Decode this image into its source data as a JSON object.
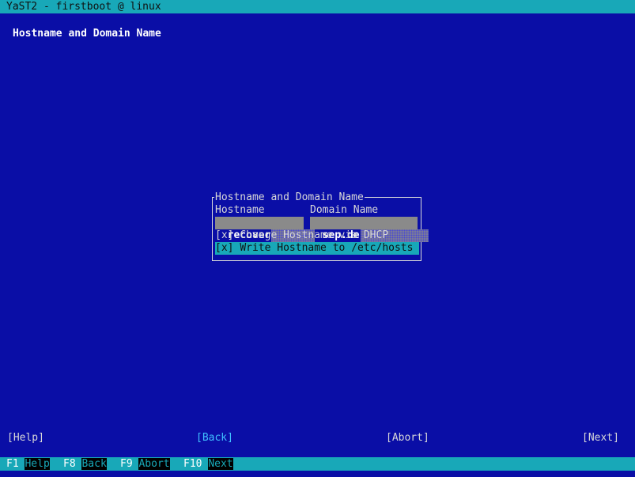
{
  "window": {
    "title": "YaST2 - firstboot @ linux"
  },
  "page": {
    "heading": "Hostname and Domain Name"
  },
  "frame": {
    "title": "Hostname and Domain Name",
    "hostname_label": "Hostname",
    "hostname_value": "recover",
    "domain_label": "Domain Name",
    "domain_value": "sep.de",
    "checkbox_dhcp": {
      "mark": "[x]",
      "label": "Change Hostname via DHCP",
      "checked": true
    },
    "checkbox_hosts": {
      "mark": "[x]",
      "label": "Write Hostname to /etc/hosts",
      "checked": true
    }
  },
  "buttons": {
    "help": "[Help]",
    "back": "[Back]",
    "abort": "[Abort]",
    "next": "[Next]"
  },
  "fkeys": [
    {
      "key": "F1",
      "label": "Help"
    },
    {
      "key": "F8",
      "label": "Back"
    },
    {
      "key": "F9",
      "label": "Abort"
    },
    {
      "key": "F10",
      "label": "Next"
    }
  ],
  "colors": {
    "background": "#0a0ea6",
    "bar": "#18a8b8",
    "highlight": "#ffff40"
  }
}
